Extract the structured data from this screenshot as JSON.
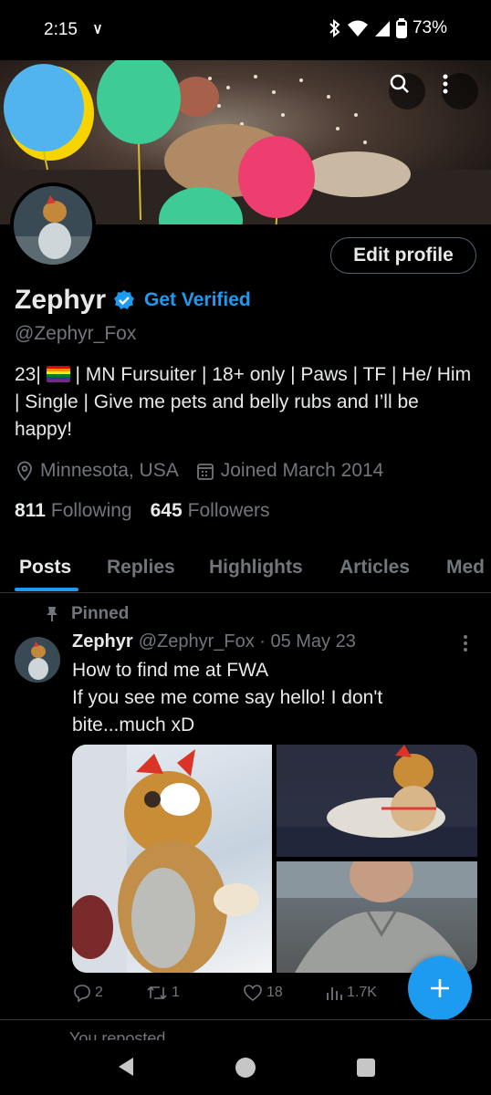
{
  "status_bar": {
    "time": "2:15",
    "battery": "73%"
  },
  "profile": {
    "name": "Zephyr",
    "get_verified": "Get Verified",
    "handle": "@Zephyr_Fox",
    "bio_prefix": "23|",
    "bio_rest": "| MN Fursuiter | 18+ only | Paws | TF | He/ Him | Single | Give me pets and belly rubs and I’ll be happy!",
    "location": "Minnesota, USA",
    "joined": "Joined March 2014",
    "following_count": "811",
    "following_label": "Following",
    "followers_count": "645",
    "followers_label": "Followers",
    "edit_profile": "Edit profile"
  },
  "tabs": [
    "Posts",
    "Replies",
    "Highlights",
    "Articles",
    "Med"
  ],
  "post": {
    "pinned_label": "Pinned",
    "author": "Zephyr",
    "handle_date": "@Zephyr_Fox · 05 May 23",
    "line1": "How to find me at FWA",
    "line2": "If you see me come say hello! I don't bite...much xD",
    "replies": "2",
    "reposts": "1",
    "likes": "18",
    "views": "1.7K"
  },
  "next_post": {
    "reposted_label": "You reposted"
  },
  "colors": {
    "accent": "#1d9bf0",
    "muted": "#71767b",
    "text": "#e7e9ea",
    "background": "#000000"
  },
  "icons": [
    "notification-icon",
    "bluetooth-icon",
    "wifi-icon",
    "signal-icon",
    "battery-icon",
    "search-icon",
    "more-icon",
    "verified-badge-icon",
    "location-icon",
    "calendar-icon",
    "pin-icon",
    "reply-icon",
    "repost-icon",
    "like-icon",
    "views-icon",
    "compose-icon",
    "nav-back-icon",
    "nav-home-icon",
    "nav-recents-icon"
  ]
}
